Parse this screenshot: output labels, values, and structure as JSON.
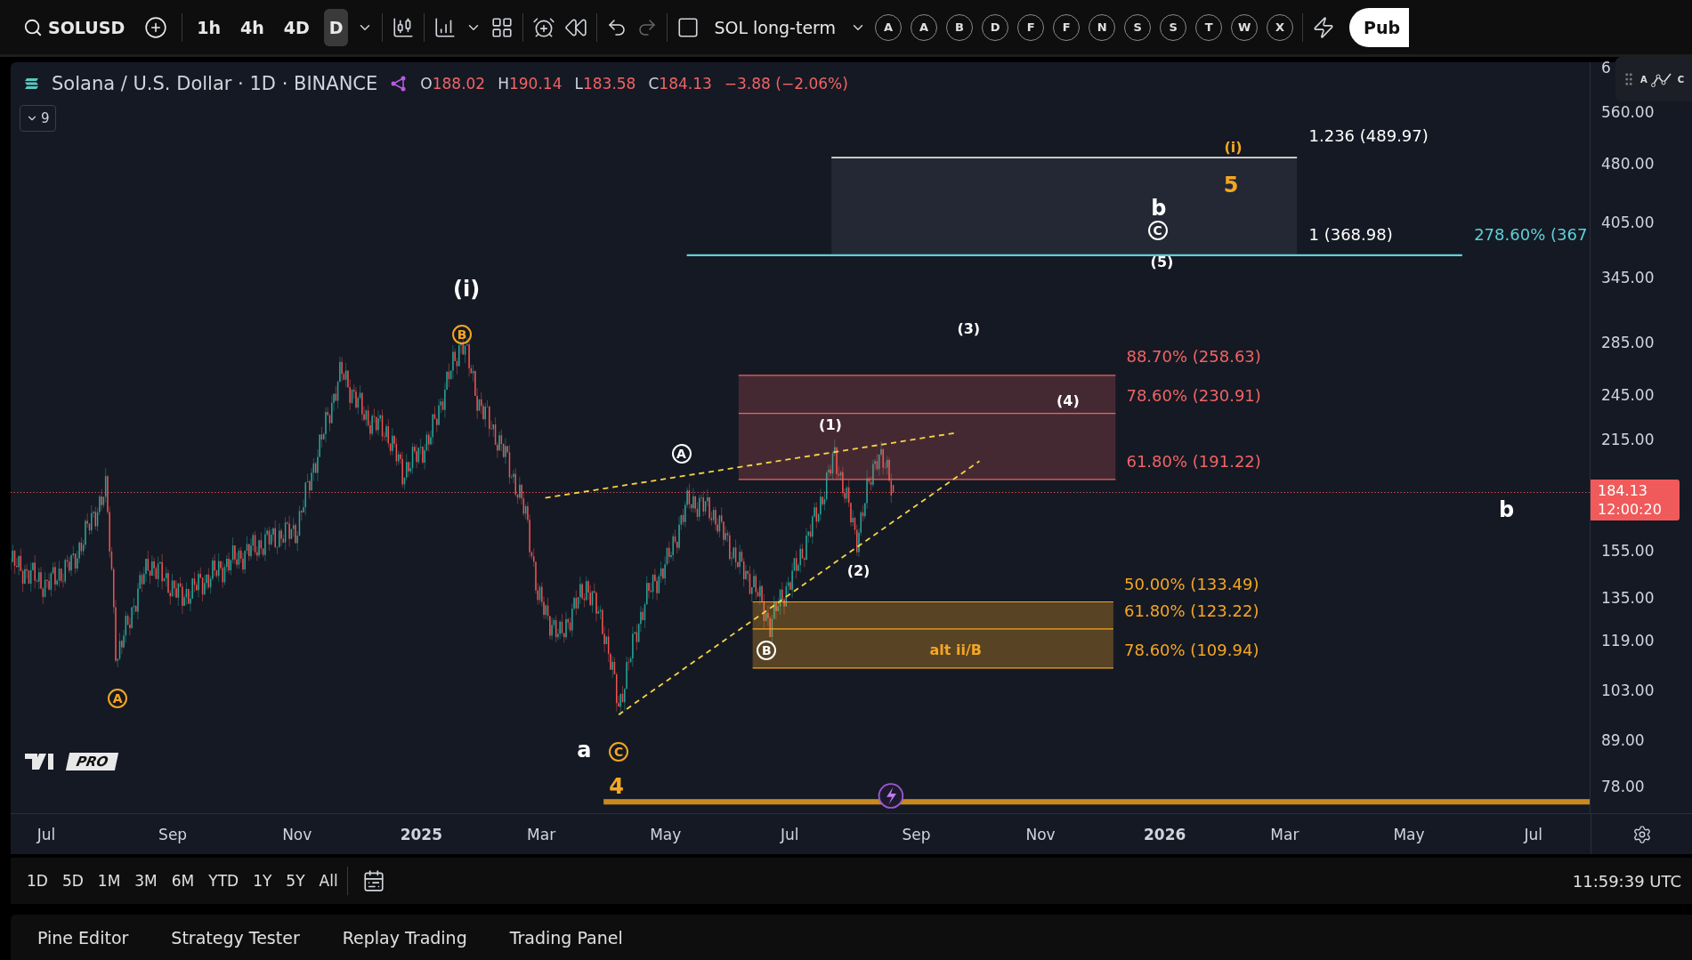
{
  "toolbar": {
    "symbol": "SOLUSD",
    "intervals": [
      {
        "label": "1h",
        "selected": false
      },
      {
        "label": "4h",
        "selected": false
      },
      {
        "label": "4D",
        "selected": false
      },
      {
        "label": "D",
        "selected": true
      }
    ],
    "redo_disabled": true,
    "layout_name": "SOL long-term",
    "favorites": [
      "A",
      "A",
      "B",
      "D",
      "F",
      "F",
      "N",
      "S",
      "S",
      "T",
      "W",
      "X"
    ],
    "publish_label": "Pub"
  },
  "legend": {
    "title": "Solana / U.S. Dollar · 1D · BINANCE",
    "ohlc": [
      {
        "key": "O",
        "value": "188.02"
      },
      {
        "key": "H",
        "value": "190.14"
      },
      {
        "key": "L",
        "value": "183.58"
      },
      {
        "key": "C",
        "value": "184.13"
      }
    ],
    "change": "−3.88 (−2.06%)",
    "collapse_count": "9"
  },
  "annotations": [
    {
      "text": "1.236 (489.97)",
      "color": "#ffffff",
      "kind": "level"
    },
    {
      "text": "1 (368.98)",
      "color": "#ffffff",
      "kind": "level"
    },
    {
      "text": "278.60% (367",
      "color": "#5fd0d6",
      "kind": "level"
    },
    {
      "text": "88.70% (258.63)",
      "color": "#f06464",
      "kind": "level"
    },
    {
      "text": "78.60% (230.91)",
      "color": "#f06464",
      "kind": "level"
    },
    {
      "text": "61.80% (191.22)",
      "color": "#f06464",
      "kind": "level"
    },
    {
      "text": "50.00% (133.49)",
      "color": "#f5a623",
      "kind": "level"
    },
    {
      "text": "61.80% (123.22)",
      "color": "#f5a623",
      "kind": "level"
    },
    {
      "text": "alt ii/B",
      "color": "#f5a623",
      "kind": "wave"
    },
    {
      "text": "78.60% (109.94)",
      "color": "#f5a623",
      "kind": "level"
    },
    {
      "text": "(i)",
      "color": "#f5a623",
      "kind": "wave"
    },
    {
      "text": "5",
      "color": "#f5a623",
      "kind": "big"
    },
    {
      "text": "b",
      "color": "#ffffff",
      "kind": "big"
    },
    {
      "text": "C",
      "color": "#ffffff",
      "kind": "circled"
    },
    {
      "text": "(5)",
      "color": "#ffffff",
      "kind": "wave"
    },
    {
      "text": "(i)",
      "color": "#ffffff",
      "kind": "big"
    },
    {
      "text": "B",
      "color": "#f5a623",
      "kind": "circled"
    },
    {
      "text": "(3)",
      "color": "#ffffff",
      "kind": "wave"
    },
    {
      "text": "(4)",
      "color": "#ffffff",
      "kind": "wave"
    },
    {
      "text": "(1)",
      "color": "#ffffff",
      "kind": "wave"
    },
    {
      "text": "A",
      "color": "#ffffff",
      "kind": "circled"
    },
    {
      "text": "(2)",
      "color": "#ffffff",
      "kind": "wave"
    },
    {
      "text": "B",
      "color": "#ffffff",
      "kind": "circled"
    },
    {
      "text": "A",
      "color": "#f5a623",
      "kind": "circled"
    },
    {
      "text": "a",
      "color": "#ffffff",
      "kind": "big"
    },
    {
      "text": "C",
      "color": "#f5a623",
      "kind": "circled"
    },
    {
      "text": "4",
      "color": "#f5a623",
      "kind": "big"
    },
    {
      "text": "b",
      "color": "#ffffff",
      "kind": "big"
    }
  ],
  "logo_badge": "PRO",
  "wave_tool_letters": [
    "A",
    "C"
  ],
  "price_axis": {
    "ticks": [
      "6",
      "560.00",
      "480.00",
      "405.00",
      "345.00",
      "285.00",
      "245.00",
      "215.00",
      "155.00",
      "135.00",
      "119.00",
      "103.00",
      "89.00",
      "78.00"
    ],
    "last_price": "184.13",
    "countdown": "12:00:20"
  },
  "time_axis": [
    {
      "label": "Jul",
      "bold": false
    },
    {
      "label": "Sep",
      "bold": false
    },
    {
      "label": "Nov",
      "bold": false
    },
    {
      "label": "2025",
      "bold": true
    },
    {
      "label": "Mar",
      "bold": false
    },
    {
      "label": "May",
      "bold": false
    },
    {
      "label": "Jul",
      "bold": false
    },
    {
      "label": "Sep",
      "bold": false
    },
    {
      "label": "Nov",
      "bold": false
    },
    {
      "label": "2026",
      "bold": true
    },
    {
      "label": "Mar",
      "bold": false
    },
    {
      "label": "May",
      "bold": false
    },
    {
      "label": "Jul",
      "bold": false
    }
  ],
  "range_bar": {
    "ranges": [
      "1D",
      "5D",
      "1M",
      "3M",
      "6M",
      "YTD",
      "1Y",
      "5Y",
      "All"
    ],
    "clock": "11:59:39 UTC"
  },
  "bottom_tabs": [
    "Pine Editor",
    "Strategy Tester",
    "Replay Trading",
    "Trading Panel"
  ]
}
